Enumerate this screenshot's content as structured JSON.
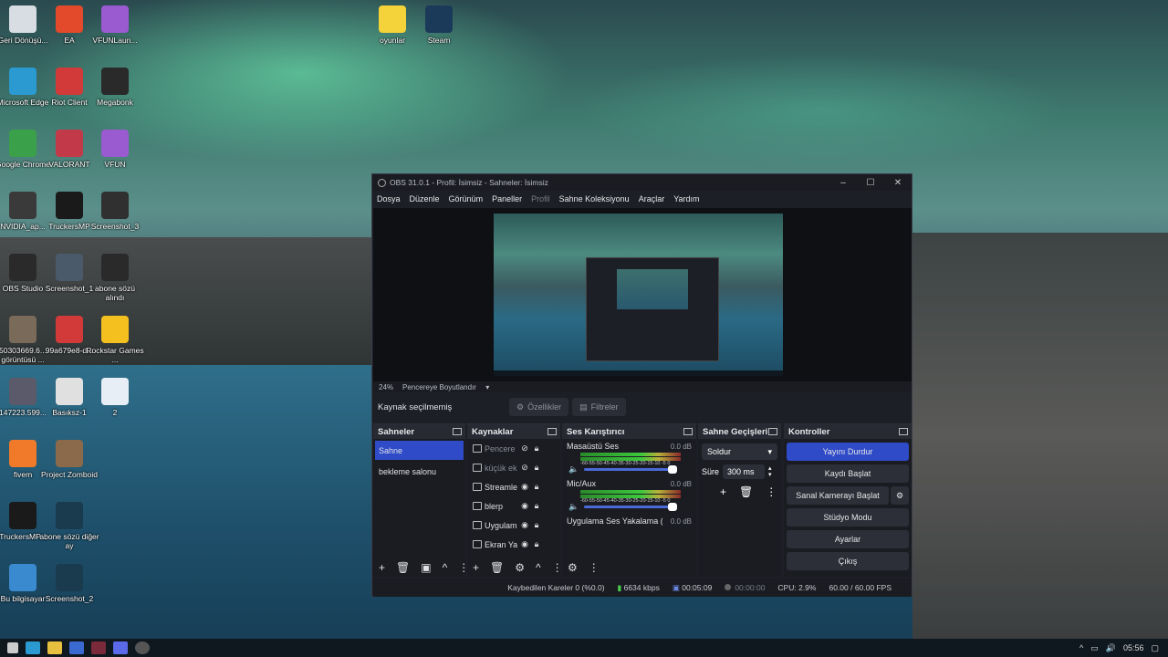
{
  "desktop_icons": [
    {
      "label": "Geri Dönüşü...",
      "icon": "recycle-bin-icon",
      "color": "#d8dde3"
    },
    {
      "label": "EA",
      "icon": "ea-icon",
      "color": "#e24a2b"
    },
    {
      "label": "VFUNLaun...",
      "icon": "vfun-icon",
      "color": "#9a5ad0"
    },
    {
      "label": "oyunlar",
      "icon": "star-folder-icon",
      "color": "#f4d23a"
    },
    {
      "label": "Steam",
      "icon": "steam-icon",
      "color": "#1b3a5a"
    },
    {
      "label": "Microsoft Edge",
      "icon": "edge-icon",
      "color": "#2a9ad0"
    },
    {
      "label": "Riot Client",
      "icon": "riot-icon",
      "color": "#d23a3a"
    },
    {
      "label": "Megabonk",
      "icon": "megabonk-icon",
      "color": "#2a2a2a"
    },
    {
      "label": "Google Chrome",
      "icon": "chrome-icon",
      "color": "#3aa04a"
    },
    {
      "label": "VALORANT",
      "icon": "valorant-icon",
      "color": "#c23a4a"
    },
    {
      "label": "VFUN",
      "icon": "vfun-icon",
      "color": "#9a5ad0"
    },
    {
      "label": "NVIDIA_ap...",
      "icon": "nvidia-icon",
      "color": "#3a3a3a"
    },
    {
      "label": "TruckersMP",
      "icon": "truckersmp-icon",
      "color": "#1a1a1a"
    },
    {
      "label": "Screenshot_3",
      "icon": "image-file-icon",
      "color": "#303030"
    },
    {
      "label": "OBS Studio",
      "icon": "obs-icon",
      "color": "#2a2a2a"
    },
    {
      "label": "Screenshot_1",
      "icon": "image-file-icon",
      "color": "#4a5a6a"
    },
    {
      "label": "abone sözü alındı",
      "icon": "image-file-icon",
      "color": "#2a2a2a"
    },
    {
      "label": "50303669.6... görüntüsü ...",
      "icon": "image-file-icon",
      "color": "#7a6a5a"
    },
    {
      "label": "99a679e8-d...",
      "icon": "pdf-icon",
      "color": "#d23a3a"
    },
    {
      "label": "Rockstar Games ...",
      "icon": "rockstar-icon",
      "color": "#f4c020"
    },
    {
      "label": "147223.599...",
      "icon": "image-file-icon",
      "color": "#5a5a6a"
    },
    {
      "label": "Basıksz-1",
      "icon": "image-file-icon",
      "color": "#e0e0e0"
    },
    {
      "label": "2",
      "icon": "text-file-icon",
      "color": "#e8eef6"
    },
    {
      "label": "fivem",
      "icon": "fivem-icon",
      "color": "#f07a2a"
    },
    {
      "label": "Project Zomboid",
      "icon": "zomboid-icon",
      "color": "#8a6a4a"
    },
    {
      "label": "TruckersMP...",
      "icon": "truckersmp-icon",
      "color": "#1a1a1a"
    },
    {
      "label": "abone sözü diğer ay",
      "icon": "blank-file-icon",
      "color": "#1a3a4e"
    },
    {
      "label": "Bu bilgisayar",
      "icon": "computer-icon",
      "color": "#3a8ad0"
    },
    {
      "label": "Screenshot_2",
      "icon": "blank-file-icon",
      "color": "#1a3a4e"
    }
  ],
  "obs": {
    "title": "OBS 31.0.1 - Profil: İsimsiz - Sahneler: İsimsiz",
    "menu": [
      "Dosya",
      "Düzenle",
      "Görünüm",
      "Paneller",
      "Profil",
      "Sahne Koleksiyonu",
      "Araçlar",
      "Yardım"
    ],
    "zoom": "24%",
    "zoom_mode": "Pencereye Boyutlandır",
    "no_source": "Kaynak seçilmemiş",
    "properties": "Özellikler",
    "filters": "Filtreler",
    "scenes": {
      "title": "Sahneler",
      "items": [
        "Sahne",
        "bekleme salonu"
      ]
    },
    "sources": {
      "title": "Kaynaklar",
      "items": [
        {
          "name": "Pencere",
          "icon": "window-icon",
          "visible": false
        },
        {
          "name": "küçük ek",
          "icon": "window-icon",
          "visible": false
        },
        {
          "name": "Streamle",
          "icon": "browser-icon",
          "visible": true
        },
        {
          "name": "blerp",
          "icon": "browser-icon",
          "visible": true
        },
        {
          "name": "Uygulam",
          "icon": "app-audio-icon",
          "visible": true
        },
        {
          "name": "Ekran Ya",
          "icon": "monitor-icon",
          "visible": true
        }
      ]
    },
    "mixer": {
      "title": "Ses Karıştırıcı",
      "channels": [
        {
          "name": "Masaüstü Ses",
          "db": "0.0 dB"
        },
        {
          "name": "Mic/Aux",
          "db": "0.0 dB"
        },
        {
          "name": "Uygulama Ses Yakalama (B",
          "db": "0.0 dB"
        }
      ],
      "scale": "-60-55-50-45-40-35-30-25-20-15-10 -5  0"
    },
    "transitions": {
      "title": "Sahne Geçişleri",
      "selected": "Soldur",
      "duration_label": "Süre",
      "duration": "300 ms"
    },
    "controls": {
      "title": "Kontroller",
      "buttons": [
        "Yayını Durdur",
        "Kaydı Başlat",
        "Sanal Kamerayı Başlat",
        "Stüdyo Modu",
        "Ayarlar",
        "Çıkış"
      ]
    },
    "status": {
      "dropped": "Kaybedilen Kareler 0 (%0.0)",
      "bitrate": "6634 kbps",
      "live_time": "00:05:09",
      "rec_time": "00:00:00",
      "cpu": "CPU: 2.9%",
      "fps": "60.00 / 60.00 FPS"
    }
  },
  "taskbar": {
    "clock": "05:56"
  }
}
